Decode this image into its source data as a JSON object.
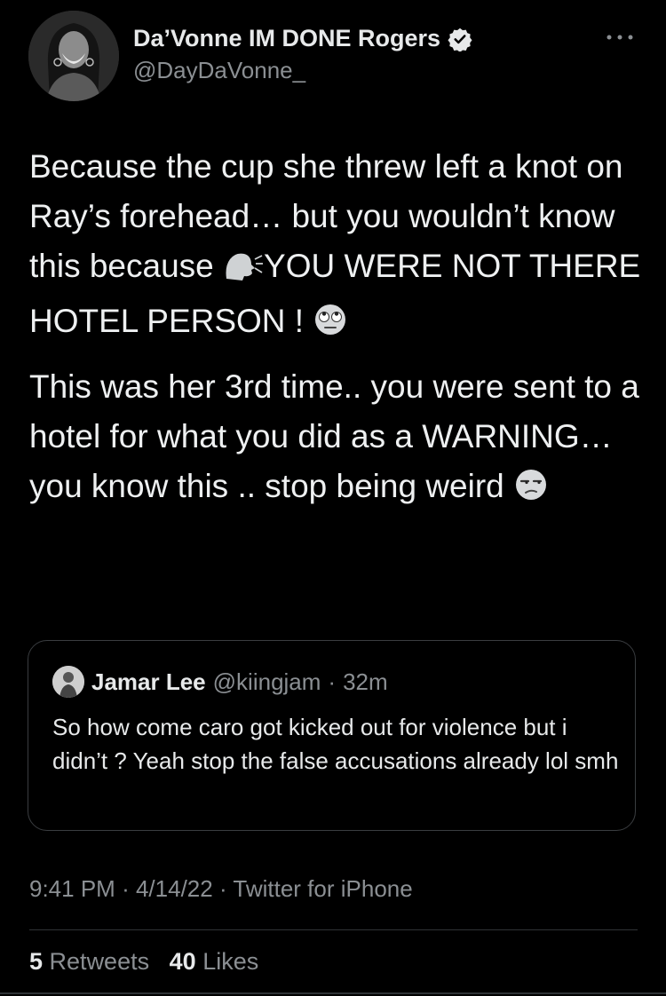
{
  "author": {
    "name": "Da’Vonne IM DONE Rogers",
    "handle": "@DayDaVonne_",
    "verified": true
  },
  "tweet": {
    "para1_a": "Because the cup she threw left a knot on Ray’s forehead… but you wouldn’t know this because ",
    "para1_b": "YOU WERE NOT THERE HOTEL PERSON ! ",
    "para2": "This was her 3rd time.. you were sent to a hotel for what you did as a WARNING… you know this ..  stop being weird ",
    "emojis": [
      "speaking-head-icon",
      "eye-roll-icon",
      "unamused-face-icon"
    ]
  },
  "quote": {
    "name": "Jamar Lee",
    "handle": "@kiingjam",
    "separator": "·",
    "time": "32m",
    "text": "So how come caro got kicked out for violence but i didn’t ? Yeah stop the false accusations already lol smh"
  },
  "meta": {
    "time": "9:41 PM",
    "date": "4/14/22",
    "source": "Twitter for iPhone",
    "separator": "·"
  },
  "stats": {
    "retweets_count": "5",
    "retweets_label": "Retweets",
    "likes_count": "40",
    "likes_label": "Likes"
  },
  "colors": {
    "background": "#000000",
    "text": "#e7e9ea",
    "secondary": "#8b8f93",
    "border": "#2f3336"
  }
}
